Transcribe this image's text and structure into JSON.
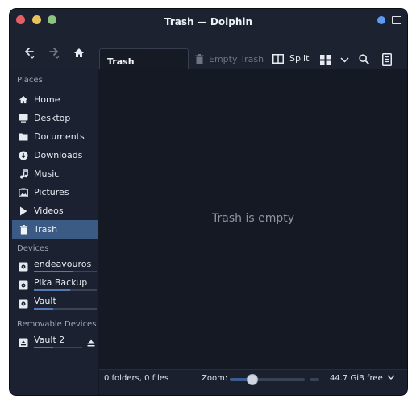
{
  "window": {
    "title": "Trash — Dolphin"
  },
  "toolbar": {
    "location": "Trash",
    "empty_trash_label": "Empty Trash",
    "split_label": "Split",
    "icons": [
      "back-icon",
      "forward-icon",
      "home-icon",
      "trash-icon",
      "split-icon",
      "grid-view-icon",
      "chevron-down-icon",
      "search-icon",
      "menu-icon"
    ]
  },
  "sidebar": {
    "places_heading": "Places",
    "places": [
      {
        "label": "Home",
        "icon": "home-icon",
        "active": false
      },
      {
        "label": "Desktop",
        "icon": "desktop-icon",
        "active": false
      },
      {
        "label": "Documents",
        "icon": "documents-icon",
        "active": false
      },
      {
        "label": "Downloads",
        "icon": "downloads-icon",
        "active": false
      },
      {
        "label": "Music",
        "icon": "music-icon",
        "active": false
      },
      {
        "label": "Pictures",
        "icon": "pictures-icon",
        "active": false
      },
      {
        "label": "Videos",
        "icon": "videos-icon",
        "active": false
      },
      {
        "label": "Trash",
        "icon": "trash-icon",
        "active": true
      }
    ],
    "devices_heading": "Devices",
    "devices": [
      {
        "label": "endeavouros",
        "icon": "drive-icon",
        "usage": 0.62
      },
      {
        "label": "Pika Backup",
        "icon": "drive-icon",
        "usage": 0.58
      },
      {
        "label": "Vault",
        "icon": "drive-icon",
        "usage": 0.31
      }
    ],
    "removable_heading": "Removable Devices",
    "removable": [
      {
        "label": "Vault 2",
        "icon": "removable-drive-icon",
        "usage": 0.4
      }
    ]
  },
  "content": {
    "empty_message": "Trash is empty"
  },
  "status": {
    "count": "0 folders, 0 files",
    "zoom_label": "Zoom:",
    "zoom_level": 0.3,
    "free_space": "44.7 GiB free"
  },
  "colors": {
    "accent": "#3b5a84",
    "window_bg": "#141924",
    "sidebar_bg": "#1b2130",
    "close": "#e55f63",
    "minimize": "#e8c35c",
    "maximize": "#8cc47e"
  }
}
